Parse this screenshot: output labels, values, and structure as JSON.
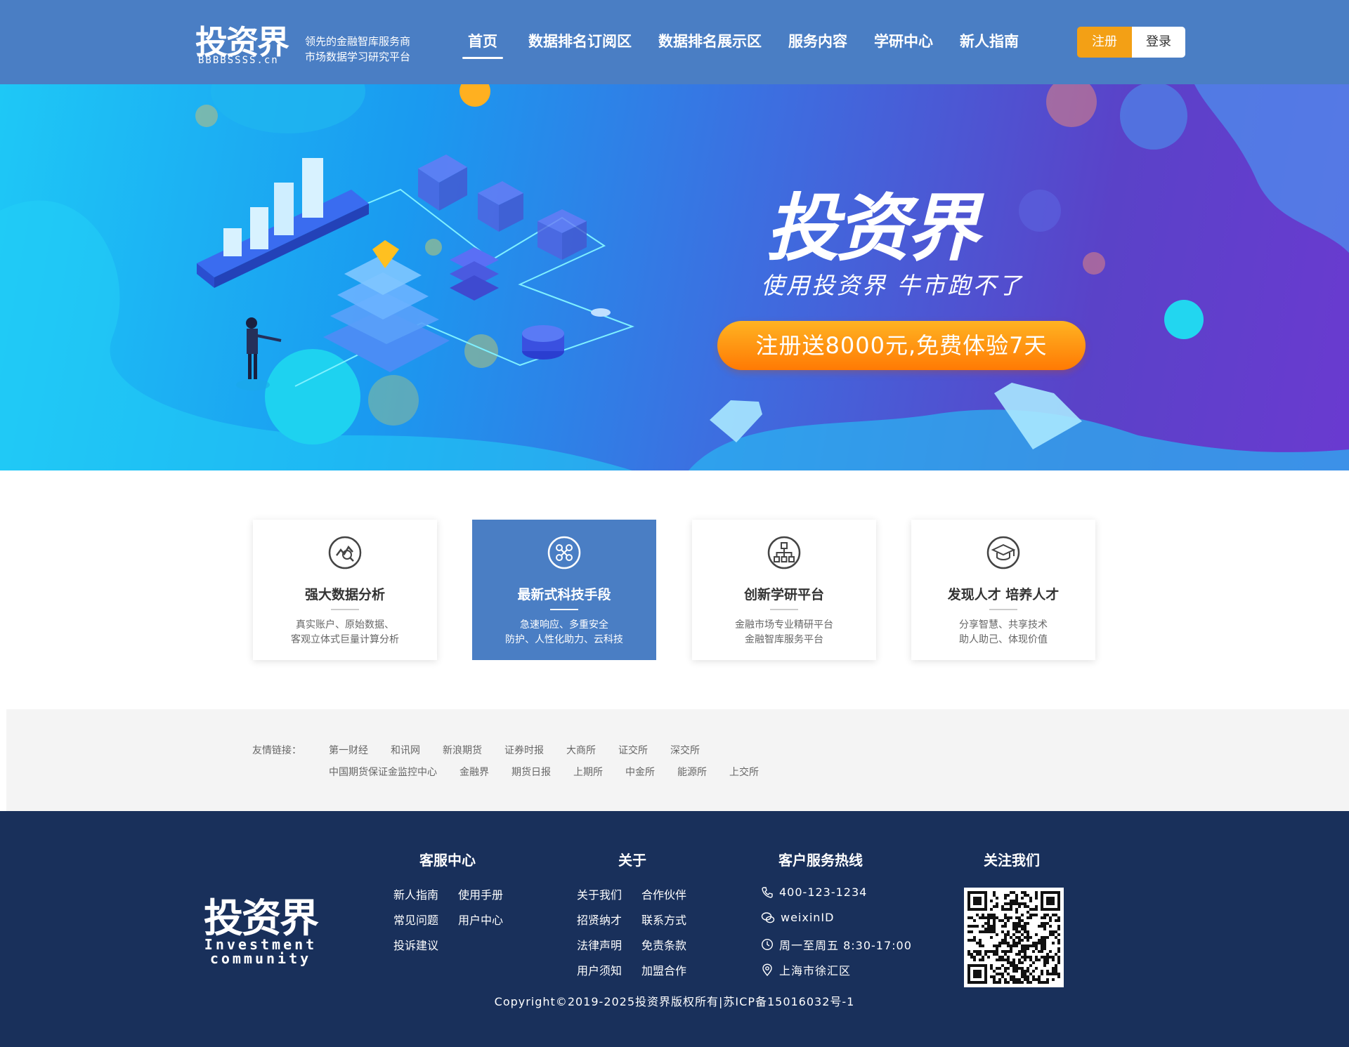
{
  "header": {
    "logo": "投资界",
    "logo_sub": "BBBBSSSS.cn",
    "slogan_line1": "领先的金融智库服务商",
    "slogan_line2": "市场数据学习研究平台",
    "nav": [
      "首页",
      "数据排名订阅区",
      "数据排名展示区",
      "服务内容",
      "学研中心",
      "新人指南"
    ],
    "active_nav": "首页",
    "register_label": "注册",
    "login_label": "登录",
    "colors": {
      "header_bg": "#4a7ec4",
      "register_bg": "#f3a015"
    }
  },
  "banner": {
    "title": "投资界",
    "slogan": "使用投资界 牛市跑不了",
    "cta": "注册送8000元,免费体验7天"
  },
  "features": [
    {
      "icon": "chart-analysis-icon",
      "title": "强大数据分析",
      "desc1": "真实账户、原始数据、",
      "desc2": "客观立体式巨量计算分析",
      "active": false
    },
    {
      "icon": "tech-network-icon",
      "title": "最新式科技手段",
      "desc1": "急速响应、多重安全",
      "desc2": "防护、人性化助力、云科技",
      "active": true
    },
    {
      "icon": "org-structure-icon",
      "title": "创新学研平台",
      "desc1": "金融市场专业精研平台",
      "desc2": "金融智库服务平台",
      "active": false
    },
    {
      "icon": "graduation-cap-icon",
      "title": "发现人才 培养人才",
      "desc1": "分享智慧、共享技术",
      "desc2": "助人助己、体现价值",
      "active": false
    }
  ],
  "friend_links": {
    "label": "友情链接：",
    "row1": [
      "第一财经",
      "和讯网",
      "新浪期货",
      "证券时报",
      "大商所",
      "证交所",
      "深交所"
    ],
    "row2": [
      "中国期货保证金监控中心",
      "金融界",
      "期货日报",
      "上期所",
      "中金所",
      "能源所",
      "上交所"
    ]
  },
  "footer": {
    "logo": "投资界",
    "logo_sub1": "Investment",
    "logo_sub2": "community",
    "service_title": "客服中心",
    "service_links": [
      "新人指南",
      "使用手册",
      "常见问题",
      "用户中心",
      "投诉建议"
    ],
    "about_title": "关于",
    "about_links": [
      "关于我们",
      "合作伙伴",
      "招贤纳才",
      "联系方式",
      "法律声明",
      "免责条款",
      "用户须知",
      "加盟合作"
    ],
    "hotline_title": "客户服务热线",
    "phone": "400-123-1234",
    "wechat": "weixinID",
    "hours": "周一至周五 8:30-17:00",
    "address": "上海市徐汇区",
    "follow_title": "关注我们",
    "copyright": "Copyright©2019-2025投资界版权所有|苏ICP备15016032号-1"
  }
}
